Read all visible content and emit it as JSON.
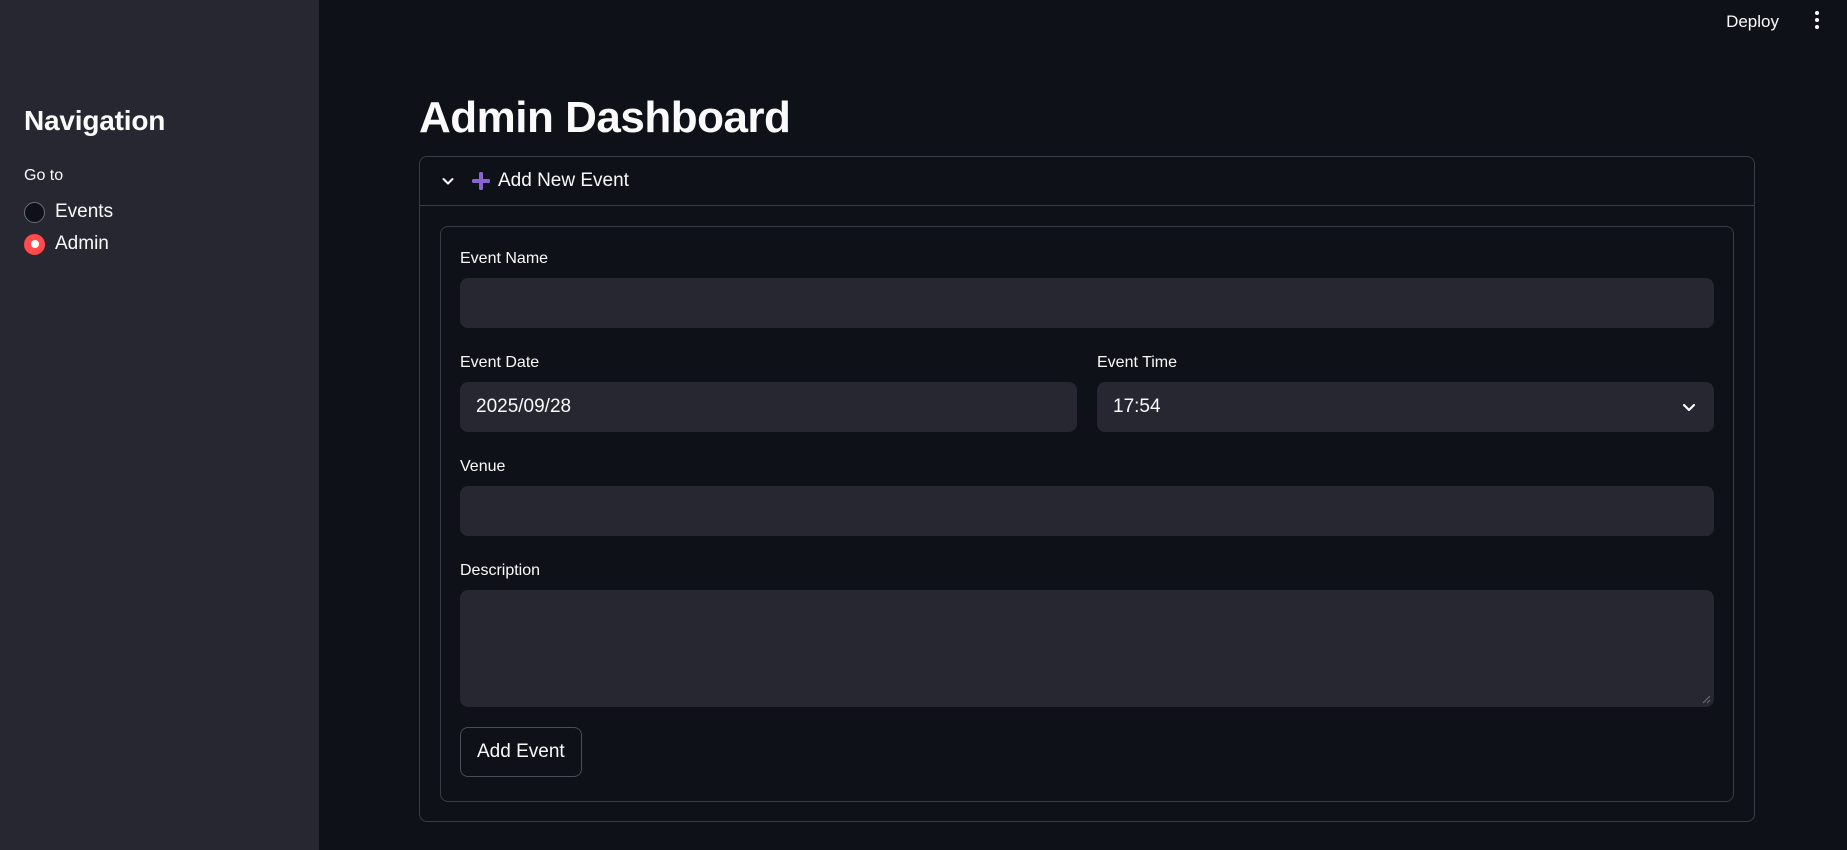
{
  "header": {
    "deploy_label": "Deploy",
    "menu_icon": "more-vertical-icon"
  },
  "sidebar": {
    "title": "Navigation",
    "radio_label": "Go to",
    "options": [
      {
        "label": "Events",
        "selected": false
      },
      {
        "label": "Admin",
        "selected": true
      }
    ],
    "accent_color": "#ff4b4b"
  },
  "main": {
    "title": "Admin Dashboard",
    "expander": {
      "title": "Add New Event",
      "expanded": true,
      "icon": "plus-icon",
      "icon_color": "#8a63d2"
    },
    "form": {
      "event_name": {
        "label": "Event Name",
        "value": ""
      },
      "event_date": {
        "label": "Event Date",
        "value": "2025/09/28"
      },
      "event_time": {
        "label": "Event Time",
        "value": "17:54"
      },
      "venue": {
        "label": "Venue",
        "value": ""
      },
      "description": {
        "label": "Description",
        "value": ""
      },
      "submit_label": "Add Event"
    }
  }
}
